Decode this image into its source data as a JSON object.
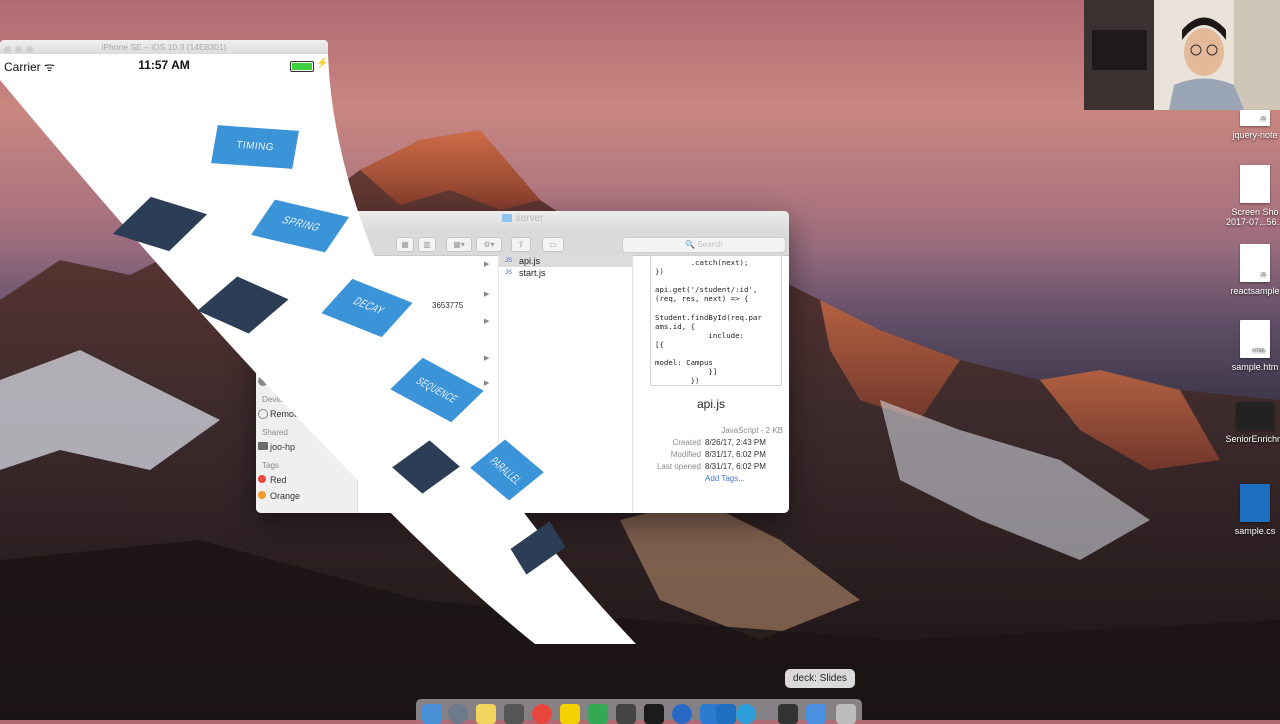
{
  "simulator": {
    "window_title": "iPhone SE – iOS 10.3 (14E8301)",
    "carrier": "Carrier",
    "time": "11:57 AM"
  },
  "animation_buttons": [
    "TIMING",
    "SPRING",
    "DECAY",
    "SEQUENCE",
    "PARALLEL"
  ],
  "finder": {
    "title": "server",
    "search_placeholder": "Search",
    "partial_value": "3653775",
    "sidebar": {
      "devices_heading": "Devices",
      "remote_disc": "Remote Disc",
      "shared_heading": "Shared",
      "shared_item": "joo-hp",
      "tags_heading": "Tags",
      "tag_red": "Red",
      "tag_orange": "Orange"
    },
    "files": [
      "api.js",
      "start.js"
    ],
    "preview": {
      "code": "        .catch(next);\n})\n\napi.get('/student/:id',\n(req, res, next) => {\n\nStudent.findById(req.par\nams.id, {\n            include:\n[{\n\nmodel: Campus\n            }]\n        })",
      "filename": "api.js",
      "kind": "JavaScript - 2 KB",
      "created_label": "Created",
      "created": "8/26/17, 2:43 PM",
      "modified_label": "Modified",
      "modified": "8/31/17, 6:02 PM",
      "opened_label": "Last opened",
      "opened": "8/31/17, 6:02 PM",
      "add_tags": "Add Tags..."
    }
  },
  "desktop_icons": [
    {
      "label": "jquery-note",
      "badge": "JS"
    },
    {
      "label": "Screen Sho\n2017-07...56.1",
      "badge": ""
    },
    {
      "label": "reactsample",
      "badge": "JS"
    },
    {
      "label": "sample.htm",
      "badge": "HTML"
    },
    {
      "label": "SeniorEnrichm",
      "badge": ""
    },
    {
      "label": "sample.cs",
      "badge": ""
    }
  ],
  "dock": {
    "tooltip": "deck: Slides"
  },
  "colors": {
    "button_blue": "#3b93d8",
    "dark_block": "#2c3e55"
  }
}
